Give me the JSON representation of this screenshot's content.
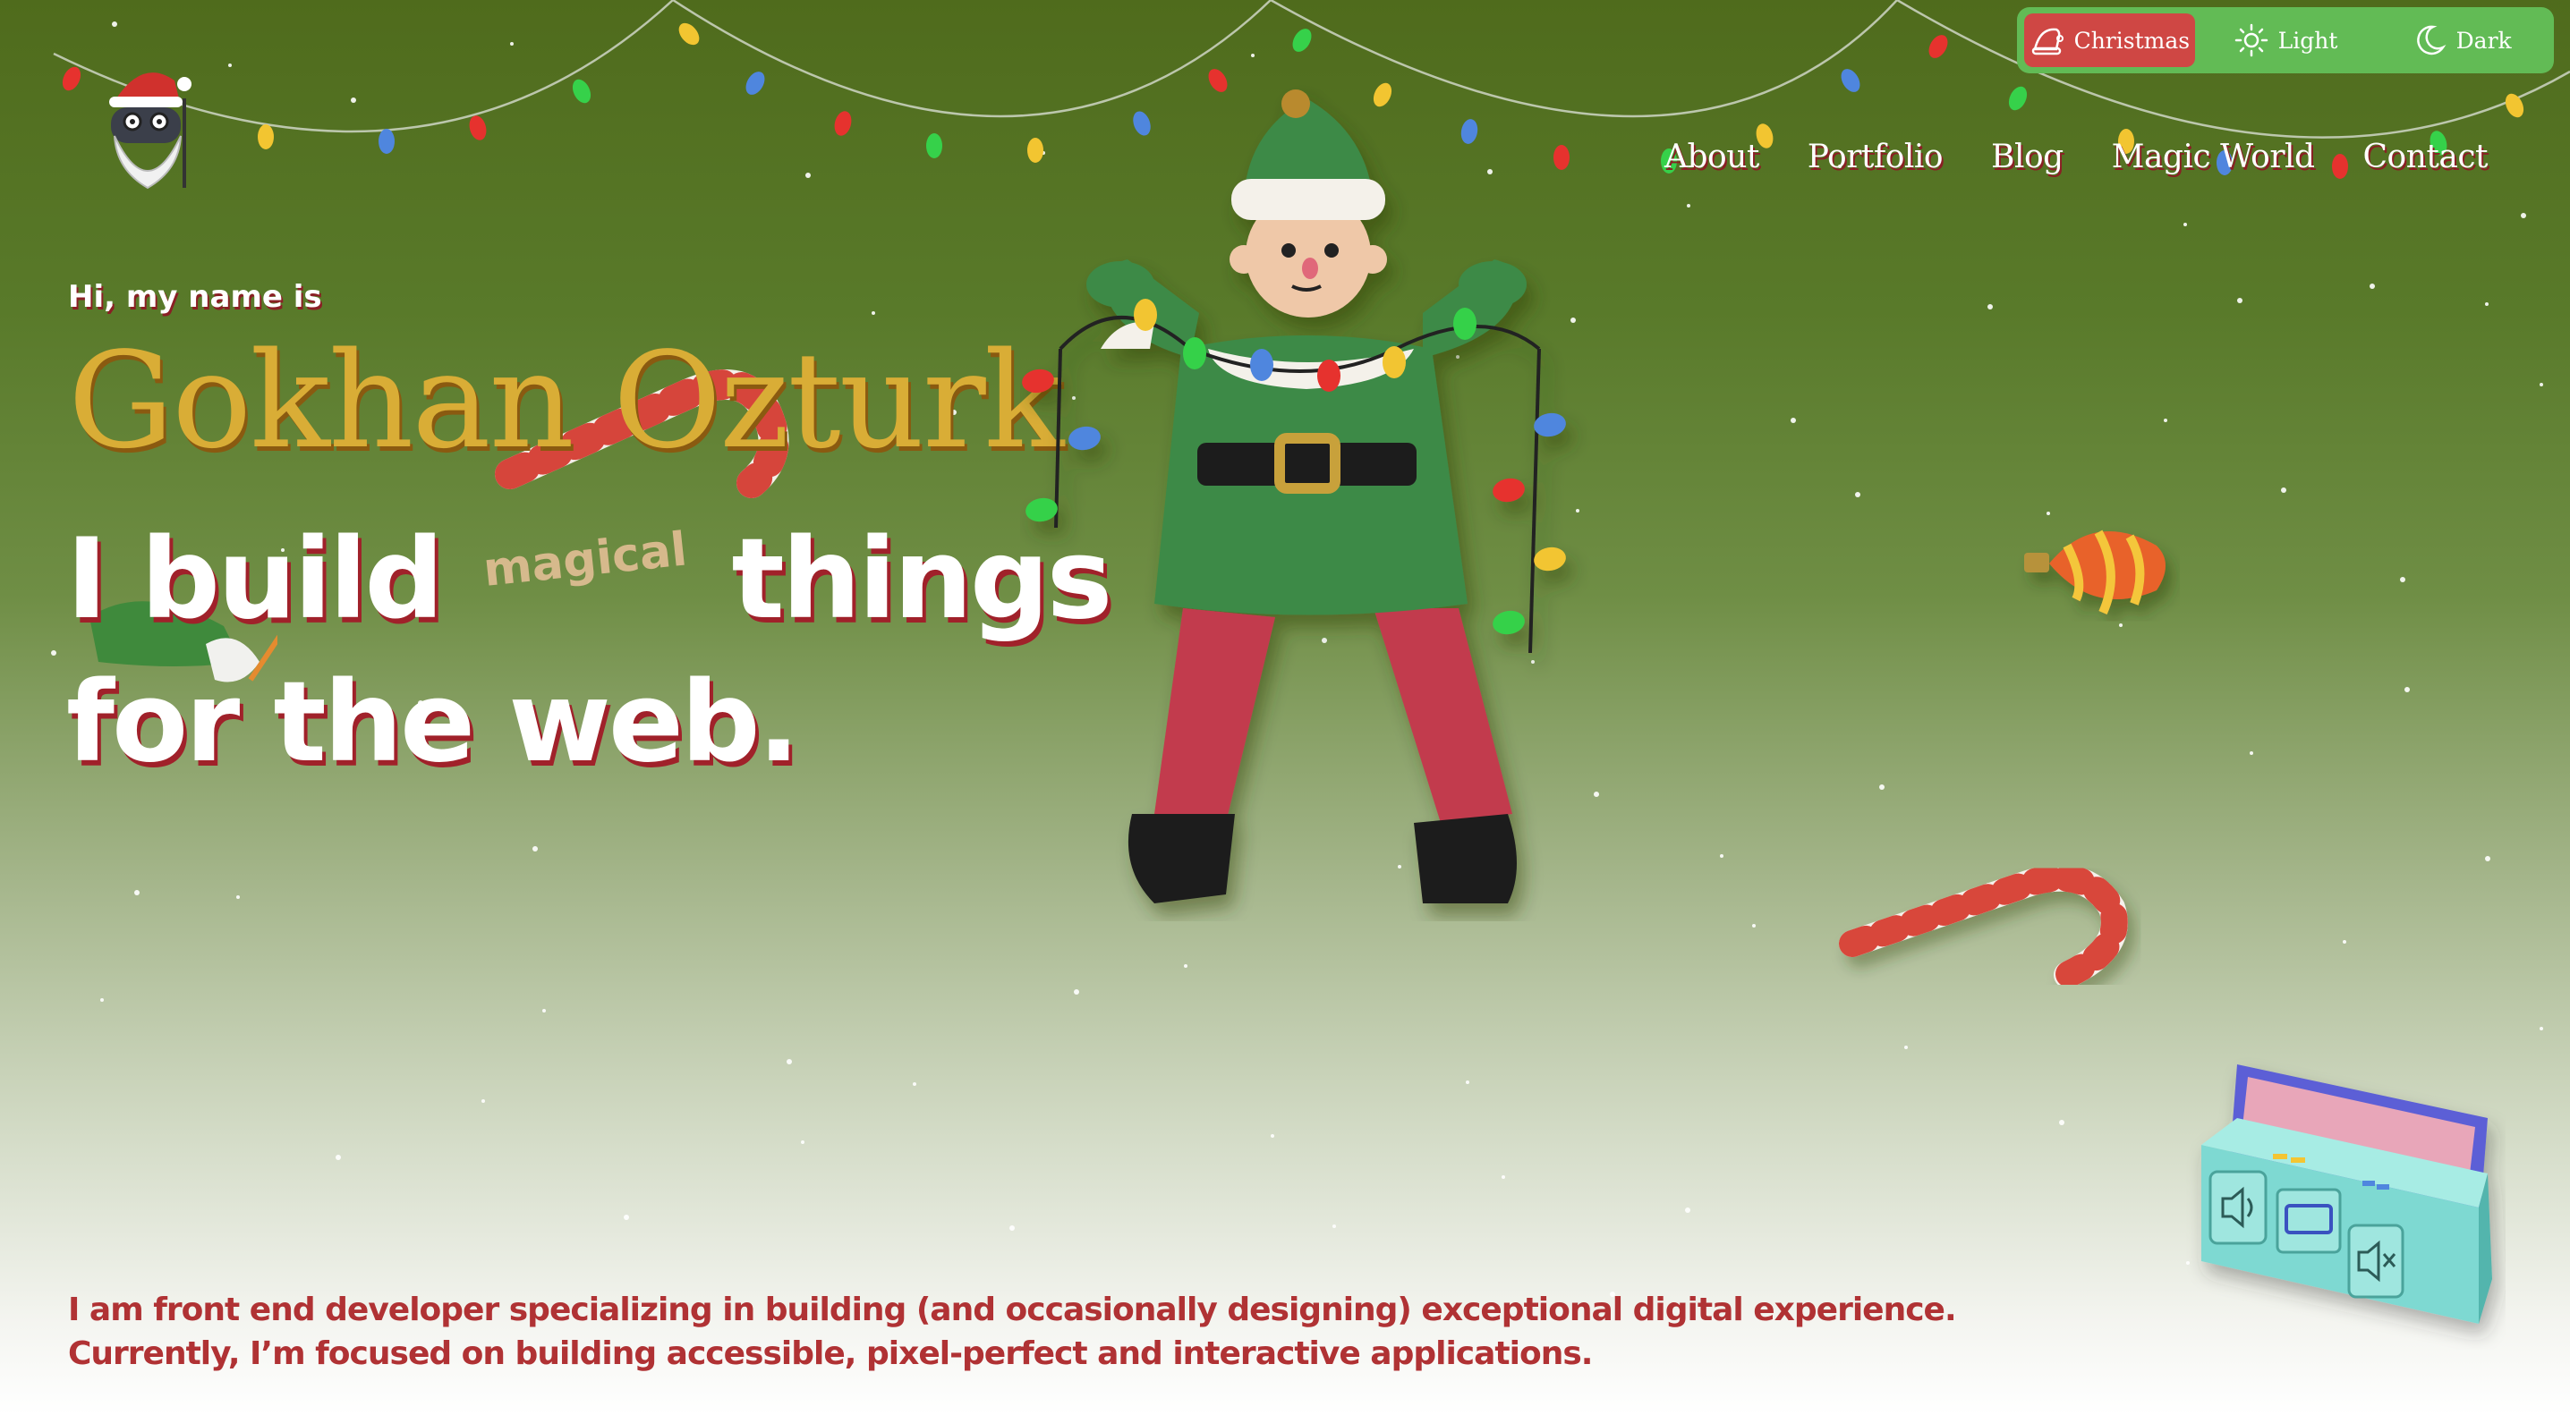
{
  "theme_switch": {
    "options": [
      {
        "label": "Christmas",
        "icon": "santa-hat-icon",
        "active": true
      },
      {
        "label": "Light",
        "icon": "sun-icon",
        "active": false
      },
      {
        "label": "Dark",
        "icon": "moon-icon",
        "active": false
      }
    ]
  },
  "nav": {
    "items": [
      "About",
      "Portfolio",
      "Blog",
      "Magic World",
      "Contact"
    ]
  },
  "hero": {
    "greeting": "Hi, my name is",
    "name": "Gokhan Ozturk",
    "tagline_start": "I build",
    "tagline_accent": "magical",
    "tagline_end": "things for the web."
  },
  "about": {
    "text": "I am front end developer specializing in building (and occasionally designing) exceptional digital experience. Currently, I’m focused on building accessible, pixel-perfect and interactive applications."
  },
  "colors": {
    "bg_top": "#4f6b1c",
    "bg_bottom": "#ffffff",
    "accent_red": "#cf4744",
    "switch_green": "#62bb55",
    "name_gold": "#d9ad36",
    "about_red": "#b03234"
  },
  "decor": {
    "character": "elf-figure",
    "ornaments": [
      "candy-cane-icon",
      "christmas-ornament-icon",
      "string-lights"
    ],
    "music_player": "boombox-icon"
  }
}
